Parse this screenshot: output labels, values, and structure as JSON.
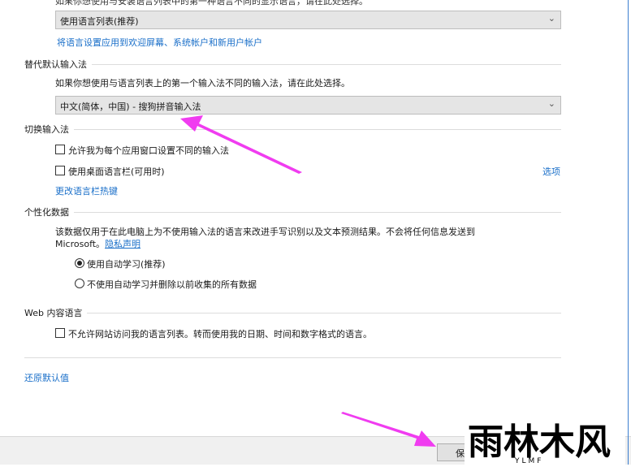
{
  "top_clipped_text": "如果你想使用与安装语言列表中的第一种语言不同的显示语言，请在此处选择。",
  "display_language_select": {
    "value": "使用语言列表(推荐)"
  },
  "apply_settings_link": "将语言设置应用到欢迎屏幕、系统帐户和新用户帐户",
  "override_input": {
    "title": "替代默认输入法",
    "description": "如果你想使用与语言列表上的第一个输入法不同的输入法，请在此处选择。",
    "select_value": "中文(简体，中国) - 搜狗拼音输入法"
  },
  "switch_input": {
    "title": "切换输入法",
    "checkbox_per_app": {
      "label": "允许我为每个应用窗口设置不同的输入法",
      "checked": false
    },
    "checkbox_langbar": {
      "label": "使用桌面语言栏(可用时)",
      "checked": false
    },
    "options_link": "选项",
    "hotkeys_link": "更改语言栏热键"
  },
  "personalization": {
    "title": "个性化数据",
    "description_line1": "该数据仅用于在此电脑上为不使用输入法的语言来改进手写识别以及文本预测结果。不会将任何信息发送到",
    "description_line2": "Microsoft。",
    "privacy_link": "隐私声明",
    "radio_auto": {
      "label": "使用自动学习(推荐)",
      "selected": true
    },
    "radio_no_auto": {
      "label": "不使用自动学习并删除以前收集的所有数据",
      "selected": false
    }
  },
  "web_content": {
    "title": "Web 内容语言",
    "checkbox": {
      "label": "不允许网站访问我的语言列表。转而使用我的日期、时间和数字格式的语言。",
      "checked": false
    }
  },
  "restore_defaults_link": "还原默认值",
  "save_button": "保存",
  "watermark": {
    "text": "雨林木风",
    "sub": "YLMF"
  },
  "colors": {
    "link": "#1a6fc9",
    "arrow": "#f03cf0"
  }
}
